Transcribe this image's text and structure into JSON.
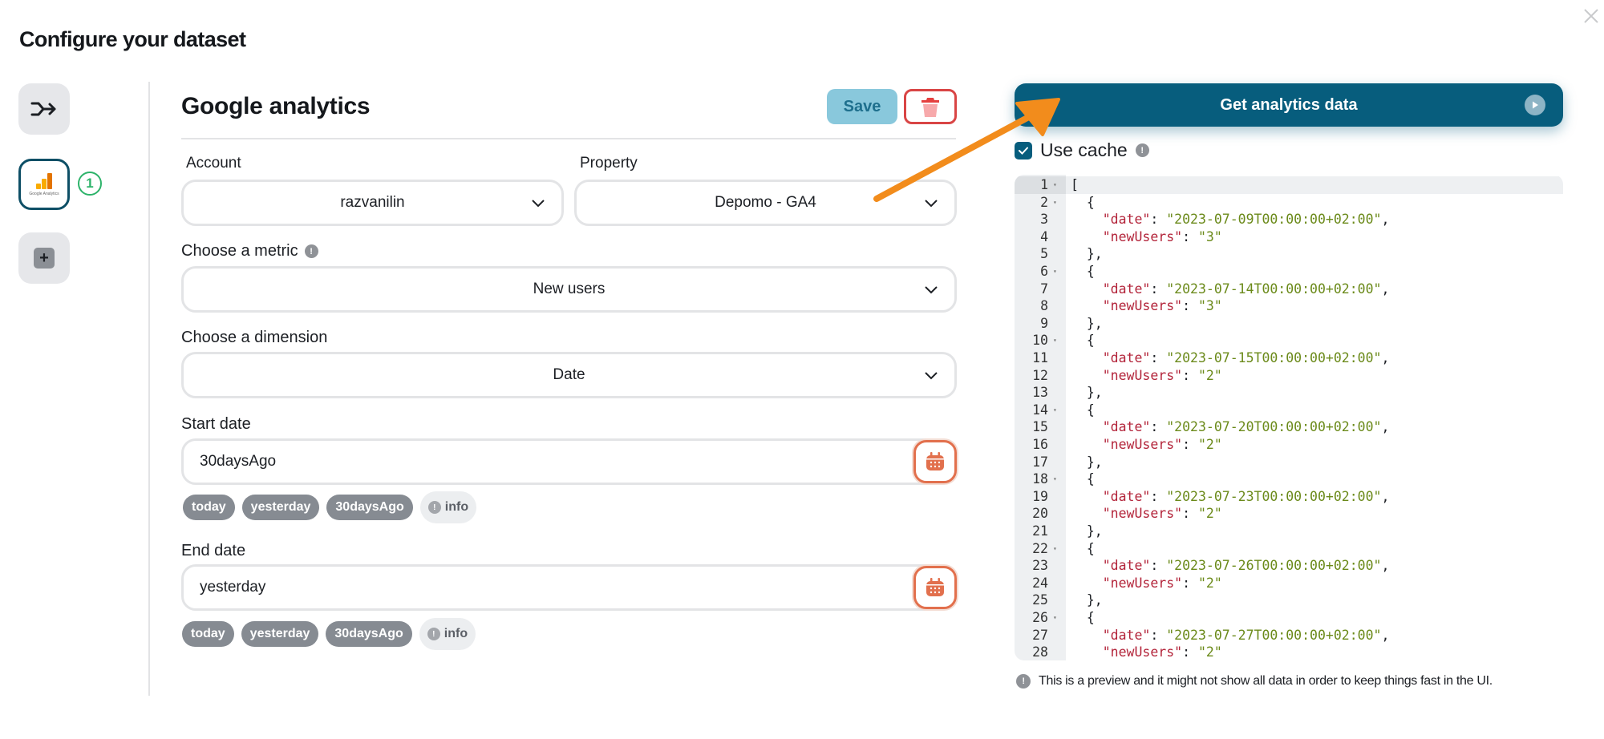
{
  "page": {
    "title": "Configure your dataset",
    "close_icon": "close-icon"
  },
  "rail": {
    "items": [
      {
        "name": "flow",
        "icon": "merge-arrow-icon"
      },
      {
        "name": "google-analytics",
        "icon": "google-analytics-logo",
        "caption": "Google Analytics",
        "badge": "1"
      },
      {
        "name": "add",
        "icon": "plus-icon",
        "label": "+"
      }
    ]
  },
  "form": {
    "title": "Google analytics",
    "save_label": "Save",
    "delete_icon": "trash-icon",
    "account": {
      "label": "Account",
      "value": "razvanilin"
    },
    "property": {
      "label": "Property",
      "value": "Depomo - GA4"
    },
    "metric": {
      "label": "Choose a metric",
      "value": "New users",
      "info": "!"
    },
    "dimension": {
      "label": "Choose a dimension",
      "value": "Date"
    },
    "start_date": {
      "label": "Start date",
      "value": "30daysAgo",
      "chips": [
        "today",
        "yesterday",
        "30daysAgo"
      ],
      "info_label": "info"
    },
    "end_date": {
      "label": "End date",
      "value": "yesterday",
      "chips": [
        "today",
        "yesterday",
        "30daysAgo"
      ],
      "info_label": "info"
    }
  },
  "results": {
    "run_label": "Get analytics data",
    "use_cache_label": "Use cache",
    "use_cache_checked": true,
    "records": [
      {
        "date": "2023-07-09T00:00:00+02:00",
        "newUsers": "3"
      },
      {
        "date": "2023-07-14T00:00:00+02:00",
        "newUsers": "3"
      },
      {
        "date": "2023-07-15T00:00:00+02:00",
        "newUsers": "2"
      },
      {
        "date": "2023-07-20T00:00:00+02:00",
        "newUsers": "2"
      },
      {
        "date": "2023-07-23T00:00:00+02:00",
        "newUsers": "2"
      },
      {
        "date": "2023-07-26T00:00:00+02:00",
        "newUsers": "2"
      },
      {
        "date": "2023-07-27T00:00:00+02:00",
        "newUsers": "2"
      }
    ],
    "visible_line_count": 28,
    "preview_note": "This is a preview and it might not show all data in order to keep things fast in the UI."
  },
  "colors": {
    "primary": "#075d7d",
    "save_bg": "#89c8dc",
    "danger": "#d94545",
    "calendar": "#e2704d",
    "annotation_arrow": "#f28c1c",
    "json_key": "#b3243a",
    "json_string": "#6b8a1a",
    "step_badge": "#2db36a"
  }
}
